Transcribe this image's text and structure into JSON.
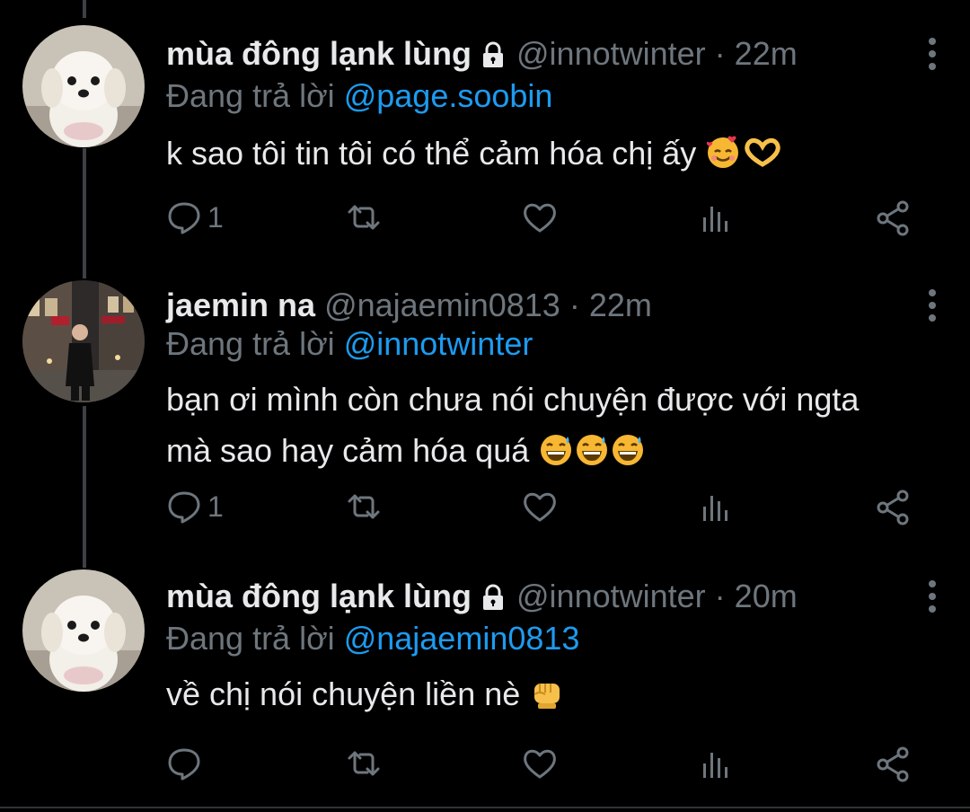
{
  "tweets": [
    {
      "name": "mùa đông lạnk lùng",
      "handle": "@innotwinter",
      "dot": "·",
      "time": "22m",
      "reply_prefix": "Đang trả lời",
      "reply_to": "@page.soobin",
      "text": "k sao tôi tin tôi có thể cảm hóa chị ấy",
      "emojis": [
        "smiling-face-with-hearts",
        "heart-hands"
      ],
      "reply_count": "1",
      "avatar": "white-puppy"
    },
    {
      "name": "jaemin na",
      "handle": "@najaemin0813",
      "dot": "·",
      "time": "22m",
      "reply_prefix": "Đang trả lời",
      "reply_to": "@innotwinter",
      "text_line1": "bạn ơi mình còn chưa nói chuyện được với ngta",
      "text_line2": "mà sao hay cảm hóa quá",
      "emojis": [
        "grinning-face-with-sweat",
        "grinning-face-with-sweat",
        "grinning-face-with-sweat"
      ],
      "reply_count": "1",
      "avatar": "street-photo"
    },
    {
      "name": "mùa đông lạnk lùng",
      "handle": "@innotwinter",
      "dot": "·",
      "time": "20m",
      "reply_prefix": "Đang trả lời",
      "reply_to": "@najaemin0813",
      "text": "về chị nói chuyện liền nè",
      "emojis": [
        "oncoming-fist"
      ],
      "reply_count": "",
      "avatar": "white-puppy"
    }
  ],
  "colors": {
    "background": "#000000",
    "text": "#e7e9ea",
    "secondary": "#6e767d",
    "mention": "#1d9bf0",
    "thread_line": "#3d4146"
  }
}
